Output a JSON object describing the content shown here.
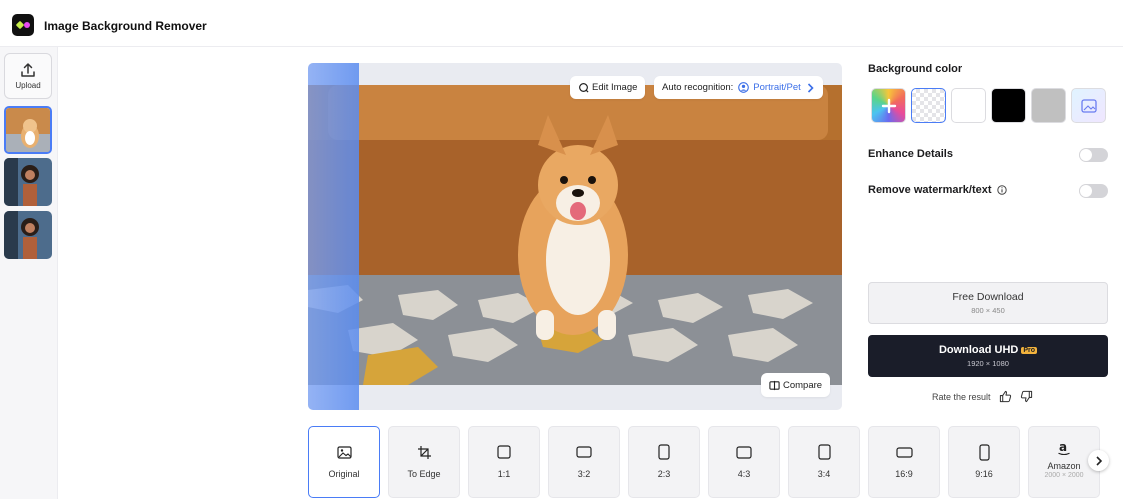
{
  "app": {
    "title": "Image Background Remover"
  },
  "sidebar": {
    "upload_label": "Upload"
  },
  "canvas": {
    "edit_label": "Edit Image",
    "auto_label": "Auto recognition:",
    "auto_value": "Portrait/Pet",
    "compare_label": "Compare"
  },
  "right": {
    "bg_color_label": "Background color",
    "enhance_label": "Enhance Details",
    "enhance_on": false,
    "watermark_label": "Remove watermark/text",
    "watermark_on": false,
    "free_label": "Free Download",
    "free_size": "800 × 450",
    "uhd_label": "Download UHD",
    "uhd_badge": "Pro",
    "uhd_size": "1920 × 1080",
    "rate_label": "Rate the result"
  },
  "swatches": [
    {
      "name": "custom-color",
      "color": "#e85a8c"
    },
    {
      "name": "transparent",
      "color": "transparent"
    },
    {
      "name": "white",
      "color": "#ffffff"
    },
    {
      "name": "black",
      "color": "#000000"
    },
    {
      "name": "gray",
      "color": "#c0c0c0"
    },
    {
      "name": "ai-background",
      "color": "#e6f0ff"
    }
  ],
  "ratios": [
    {
      "label": "Original",
      "icon": "image-icon",
      "selected": true
    },
    {
      "label": "To Edge",
      "icon": "crop-icon"
    },
    {
      "label": "1:1",
      "icon": "square-icon"
    },
    {
      "label": "3:2",
      "icon": "landscape-icon"
    },
    {
      "label": "2:3",
      "icon": "portrait-icon"
    },
    {
      "label": "4:3",
      "icon": "landscape-icon"
    },
    {
      "label": "3:4",
      "icon": "portrait-icon"
    },
    {
      "label": "16:9",
      "icon": "wide-icon"
    },
    {
      "label": "9:16",
      "icon": "tall-icon"
    },
    {
      "label": "Amazon",
      "icon": "amazon-icon",
      "sub": "2000 × 2000"
    }
  ]
}
